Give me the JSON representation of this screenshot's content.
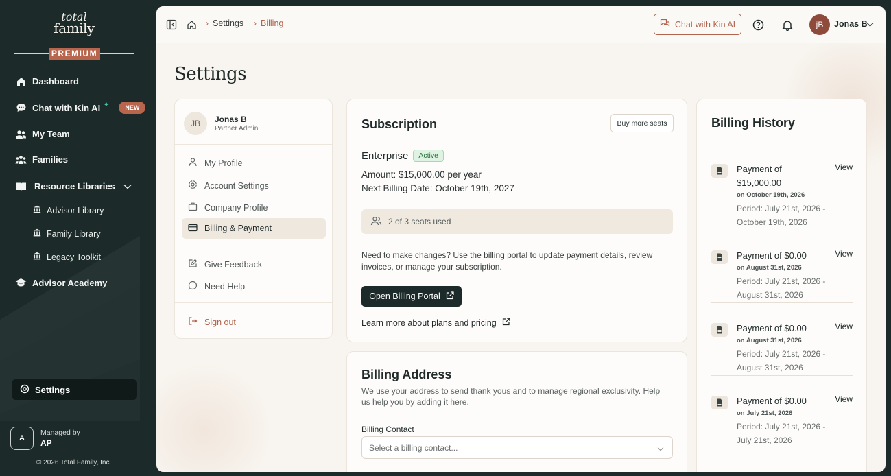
{
  "sidebar": {
    "logo_top": "total",
    "logo_bottom": "family",
    "tier": "PREMIUM",
    "items": [
      {
        "label": "Dashboard",
        "icon": "home-icon"
      },
      {
        "label": "Chat with Kin AI",
        "icon": "chat-icon",
        "badge": "NEW"
      },
      {
        "label": "My Team",
        "icon": "team-icon"
      },
      {
        "label": "Families",
        "icon": "families-icon"
      },
      {
        "label": "Resource Libraries",
        "icon": "book-icon"
      },
      {
        "label": "Advisor Library",
        "icon": "library-icon"
      },
      {
        "label": "Family Library",
        "icon": "library-icon"
      },
      {
        "label": "Legacy Toolkit",
        "icon": "library-icon"
      },
      {
        "label": "Advisor Academy",
        "icon": "graduation-cap-icon"
      }
    ],
    "settings_label": "Settings",
    "managed_by_label": "Managed by",
    "managed_by_initial": "A",
    "managed_by_name": "AP",
    "copyright": "© 2026 Total Family, Inc"
  },
  "topbar": {
    "breadcrumb": [
      "Settings",
      "Billing"
    ],
    "chat_button": "Chat with Kin AI",
    "user_initials": "jB",
    "user_name": "Jonas B"
  },
  "page_title": "Settings",
  "profile_card": {
    "initials": "JB",
    "name": "Jonas B",
    "role": "Partner Admin",
    "menu": [
      "My Profile",
      "Account Settings",
      "Company Profile",
      "Billing & Payment",
      "Give Feedback",
      "Need Help"
    ],
    "sign_out": "Sign out"
  },
  "subscription": {
    "title": "Subscription",
    "buy_more_seats": "Buy more seats",
    "plan": "Enterprise",
    "status": "Active",
    "amount": "Amount: $15,000.00 per year",
    "next_billing": "Next Billing Date: October 19th, 2027",
    "seats": "2 of 3 seats used",
    "description": "Need to make changes? Use the billing portal to update payment details, review invoices, or manage your subscription.",
    "portal_button": "Open Billing Portal",
    "learn_more": "Learn more about plans and pricing"
  },
  "billing_address": {
    "title": "Billing Address",
    "subtitle": "We use your address to send thank yous and to manage regional exclusivity. Help us help you by adding it here.",
    "contact_label": "Billing Contact",
    "contact_placeholder": "Select a billing contact..."
  },
  "billing_history": {
    "title": "Billing History",
    "view_label": "View",
    "items": [
      {
        "payment": "Payment of $15,000.00",
        "on": "on October 19th, 2026",
        "period": "Period: July 21st, 2026 - October 19th, 2026"
      },
      {
        "payment": "Payment of $0.00",
        "on": "on August 31st, 2026",
        "period": "Period: July 21st, 2026 - August 31st, 2026"
      },
      {
        "payment": "Payment of $0.00",
        "on": "on August 31st, 2026",
        "period": "Period: July 21st, 2026 - August 31st, 2026"
      },
      {
        "payment": "Payment of $0.00",
        "on": "on July 21st, 2026",
        "period": "Period: July 21st, 2026 - July 21st, 2026"
      }
    ]
  },
  "colors": {
    "sidebar_bg": "#1c2a29",
    "accent": "#b0634d",
    "page_bg": "#f8f5f0"
  }
}
